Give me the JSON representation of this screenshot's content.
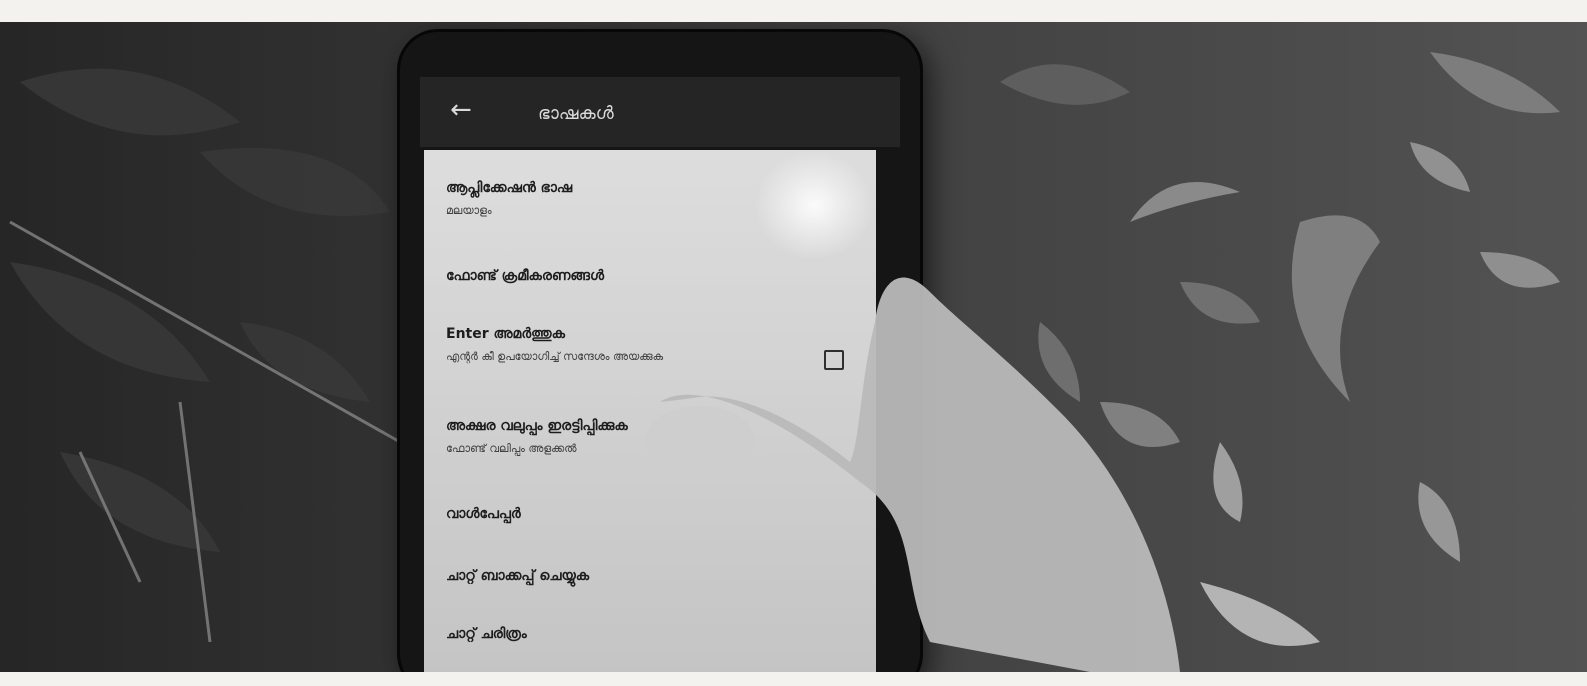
{
  "status_bar": {
    "text": ""
  },
  "app_bar": {
    "back_icon": "arrow-left-icon",
    "title": "ഭാഷകൾ"
  },
  "settings": {
    "items": [
      {
        "title": "ആപ്ലിക്കേഷൻ ഭാഷ",
        "subtitle": "മലയാളം"
      },
      {
        "title": "ഫോണ്ട് ക്രമീകരണങ്ങൾ",
        "subtitle": ""
      },
      {
        "title": "Enter അമർത്തുക",
        "subtitle": "എന്റർ കീ ഉപയോഗിച്ച് സന്ദേശം അയക്കുക"
      },
      {
        "title": "അക്ഷര വലുപ്പം ഇരട്ടിപ്പിക്കുക",
        "subtitle": "ഫോണ്ട് വലിപ്പം അളക്കൽ"
      },
      {
        "title": "വാൾപേപ്പർ",
        "subtitle": ""
      },
      {
        "title": "ചാറ്റ് ബാക്കപ്പ് ചെയ്യുക",
        "subtitle": ""
      },
      {
        "title": "ചാറ്റ് ചരിത്രം",
        "subtitle": ""
      }
    ],
    "enter_checkbox": {
      "checked": false
    }
  },
  "colors": {
    "screen_bg": "#dcd8d2",
    "app_bar_bg": "#2b2928",
    "phone_body": "#1b1a19"
  }
}
